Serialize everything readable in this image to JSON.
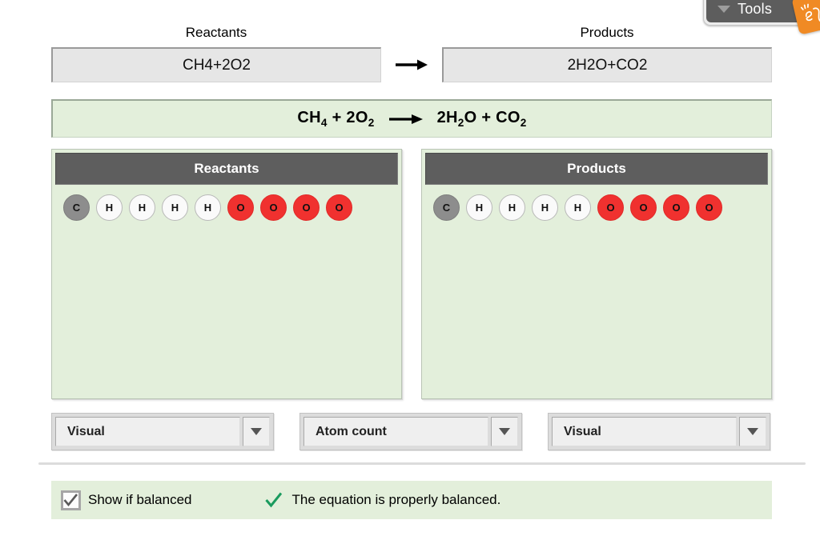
{
  "tools": {
    "label": "Tools",
    "caret_icon": "chevron-down-icon",
    "badge_icon": "explorelearning-logo-icon",
    "badge_color": "#f08a24",
    "bar_color": "#5d5d5d"
  },
  "columns": {
    "reactants_label": "Reactants",
    "products_label": "Products"
  },
  "inputs": {
    "reactants_value": "CH4+2O2",
    "products_value": "2H2O+CO2",
    "arrow_icon": "right-arrow-icon"
  },
  "equation": {
    "left_formula_1": "CH",
    "left_sub_1": "4",
    "left_plus": " + 2O",
    "left_sub_2": "2",
    "arrow_icon": "right-arrow-icon",
    "right_formula_1": "2H",
    "right_sub_1": "2",
    "right_formula_2": "O + CO",
    "right_sub_2": "2",
    "plain_text": "CH4 + 2O2 -> 2H2O + CO2",
    "background_color": "#e3efdb"
  },
  "panels": {
    "reactants": {
      "title": "Reactants",
      "atoms": [
        {
          "symbol": "C",
          "type": "carbon"
        },
        {
          "symbol": "H",
          "type": "hydrogen"
        },
        {
          "symbol": "H",
          "type": "hydrogen"
        },
        {
          "symbol": "H",
          "type": "hydrogen"
        },
        {
          "symbol": "H",
          "type": "hydrogen"
        },
        {
          "symbol": "O",
          "type": "oxygen"
        },
        {
          "symbol": "O",
          "type": "oxygen"
        },
        {
          "symbol": "O",
          "type": "oxygen"
        },
        {
          "symbol": "O",
          "type": "oxygen"
        }
      ]
    },
    "products": {
      "title": "Products",
      "atoms": [
        {
          "symbol": "C",
          "type": "carbon"
        },
        {
          "symbol": "H",
          "type": "hydrogen"
        },
        {
          "symbol": "H",
          "type": "hydrogen"
        },
        {
          "symbol": "H",
          "type": "hydrogen"
        },
        {
          "symbol": "H",
          "type": "hydrogen"
        },
        {
          "symbol": "O",
          "type": "oxygen"
        },
        {
          "symbol": "O",
          "type": "oxygen"
        },
        {
          "symbol": "O",
          "type": "oxygen"
        },
        {
          "symbol": "O",
          "type": "oxygen"
        }
      ]
    },
    "atom_colors": {
      "carbon": "#8d8d8d",
      "hydrogen": "#fafafa",
      "oxygen": "#f0312f"
    },
    "header_color": "#5e5e5e"
  },
  "dropdowns": {
    "left": {
      "value": "Visual",
      "arrow_icon": "chevron-down-icon"
    },
    "middle": {
      "value": "Atom count",
      "arrow_icon": "chevron-down-icon"
    },
    "right": {
      "value": "Visual",
      "arrow_icon": "chevron-down-icon"
    }
  },
  "status": {
    "checkbox_label": "Show if balanced",
    "checkbox_checked": true,
    "check_icon": "checkmark-icon",
    "message": "The equation is properly balanced.",
    "message_icon": "green-checkmark-icon",
    "message_icon_color": "#1a9b5e"
  }
}
